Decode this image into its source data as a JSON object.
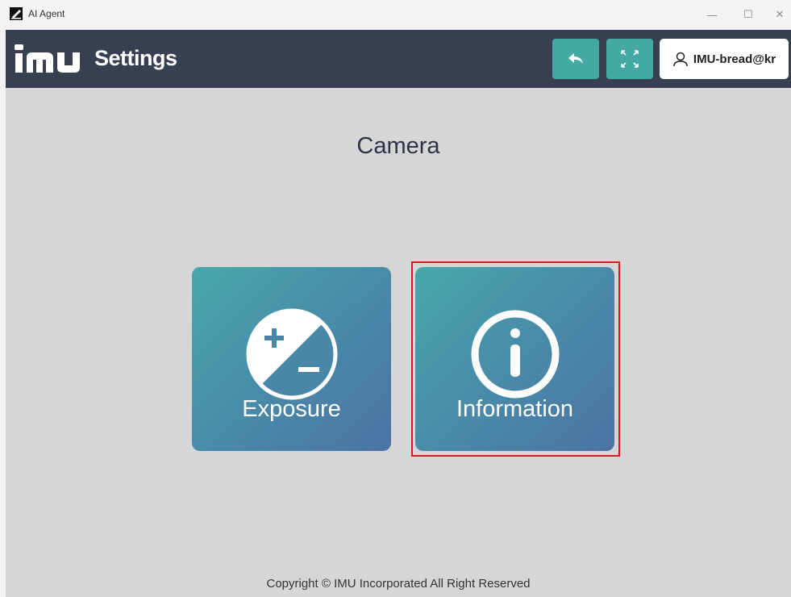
{
  "window": {
    "title": "AI Agent",
    "controls": {
      "minimize": "—",
      "maximize": "☐",
      "close": "✕"
    }
  },
  "header": {
    "logo_text": "IMU",
    "title": "Settings",
    "user_label": "IMU-bread@kr"
  },
  "main": {
    "page_title": "Camera",
    "tiles": [
      {
        "label": "Exposure",
        "icon": "exposure-icon"
      },
      {
        "label": "Information",
        "icon": "info-icon"
      }
    ]
  },
  "footer": {
    "copyright": "Copyright © IMU Incorporated All Right Reserved"
  },
  "colors": {
    "header_bg": "#373f51",
    "accent": "#45a8a4",
    "content_bg": "#d6d6d6",
    "highlight": "#e0161b"
  }
}
